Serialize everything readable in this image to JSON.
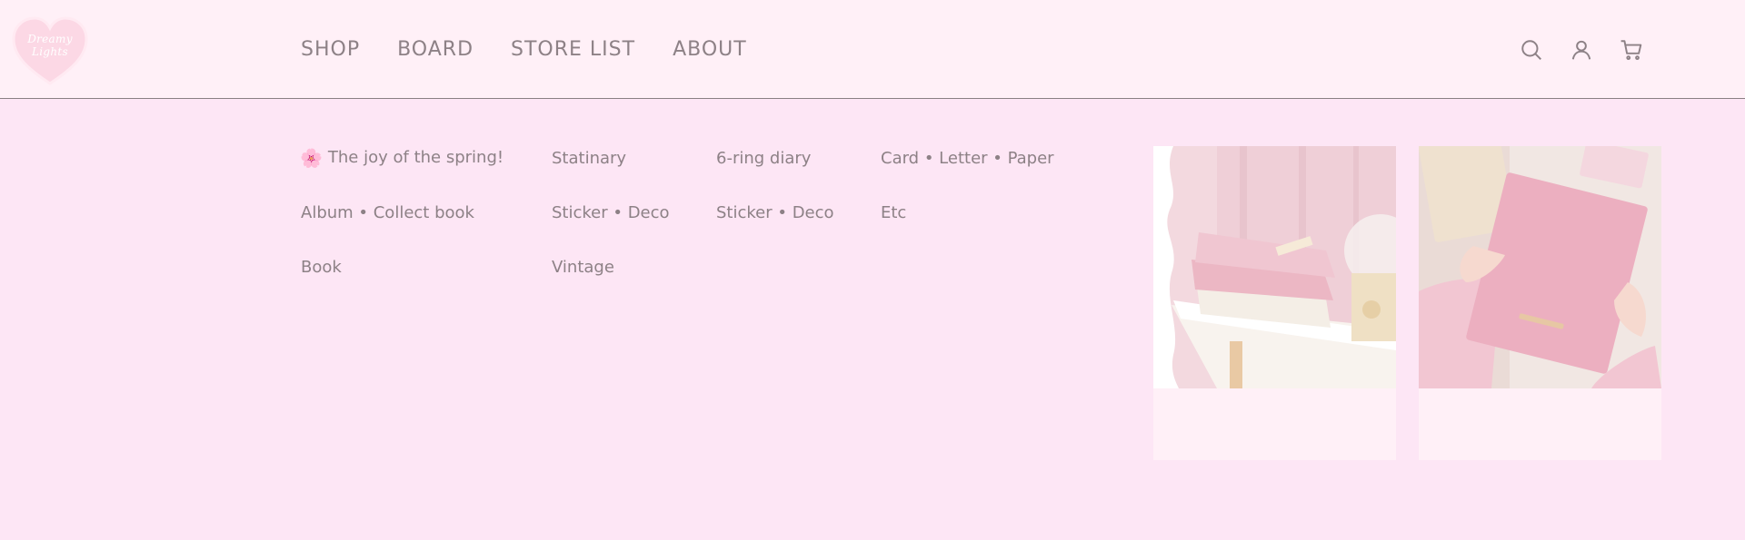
{
  "logo": {
    "line1": "Dreamy",
    "line2": "Lights"
  },
  "nav": {
    "items": [
      {
        "label": "SHOP",
        "name": "nav-shop"
      },
      {
        "label": "BOARD",
        "name": "nav-board"
      },
      {
        "label": "STORE LIST",
        "name": "nav-store-list"
      },
      {
        "label": "ABOUT",
        "name": "nav-about"
      }
    ]
  },
  "header_icons": [
    "search-icon",
    "user-icon",
    "cart-icon"
  ],
  "menu": {
    "col1": [
      "The joy of the spring!",
      "Album • Collect book",
      "Book"
    ],
    "col2": [
      "Statinary",
      "Sticker • Deco",
      "Vintage"
    ],
    "col3": [
      "6-ring diary",
      "Sticker • Deco"
    ],
    "col4": [
      "Card • Letter • Paper",
      "Etc"
    ]
  },
  "colors": {
    "header_bg": "#fff0f7",
    "menu_bg": "#fde6f5",
    "text": "#8d8186",
    "card_footer": "#fff0f7"
  }
}
